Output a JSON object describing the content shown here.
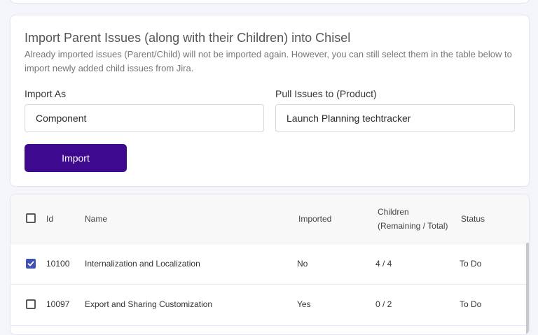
{
  "import_section": {
    "title": "Import Parent Issues (along with their Children) into Chisel",
    "description": "Already imported issues (Parent/Child) will not be imported again. However, you can still select them in the table below to import newly added child issues from Jira.",
    "import_as": {
      "label": "Import As",
      "value": "Component"
    },
    "pull_to": {
      "label": "Pull Issues to (Product)",
      "value": "Launch Planning techtracker"
    },
    "import_button": "Import"
  },
  "table": {
    "headers": {
      "id": "Id",
      "name": "Name",
      "imported": "Imported",
      "children_line1": "Children",
      "children_line2": "(Remaining / Total)",
      "status": "Status"
    },
    "rows": [
      {
        "checked": true,
        "id": "10100",
        "name": "Internalization and Localization",
        "imported": "No",
        "children": "4 / 4",
        "status": "To Do"
      },
      {
        "checked": false,
        "id": "10097",
        "name": "Export and Sharing Customization",
        "imported": "Yes",
        "children": "0 / 2",
        "status": "To Do"
      }
    ]
  },
  "colors": {
    "primary_button": "#3d0a8f",
    "checkbox_checked": "#3f51b5",
    "page_background": "#f3f5fb"
  },
  "icons": {
    "checkmark": "check-icon"
  }
}
